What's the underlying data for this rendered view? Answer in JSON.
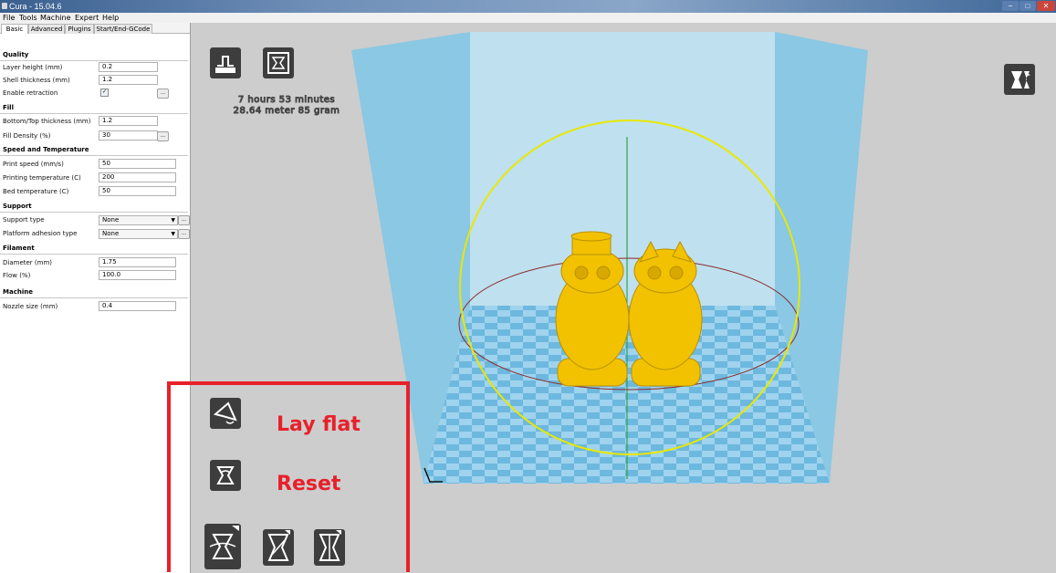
{
  "window": {
    "title": "Cura - 15.04.6",
    "controls": {
      "minimize": "−",
      "maximize": "□",
      "close": "✕"
    },
    "titlebar_color": "#3a5f8f"
  },
  "menu": [
    "File",
    "Tools",
    "Machine",
    "Expert",
    "Help"
  ],
  "tabs": [
    {
      "label": "Basic",
      "active": true
    },
    {
      "label": "Advanced",
      "active": false
    },
    {
      "label": "Plugins",
      "active": false
    },
    {
      "label": "Start/End-GCode",
      "active": false
    }
  ],
  "settings": {
    "quality": {
      "title": "Quality",
      "layer_height": {
        "label": "Layer height (mm)",
        "value": "0.2"
      },
      "shell_thickness": {
        "label": "Shell thickness (mm)",
        "value": "1.2"
      },
      "enable_retraction": {
        "label": "Enable retraction",
        "checked": true,
        "check_mark": "✓"
      }
    },
    "fill": {
      "title": "Fill",
      "bottom_top_thickness": {
        "label": "Bottom/Top thickness (mm)",
        "value": "1.2"
      },
      "fill_density": {
        "label": "Fill Density (%)",
        "value": "30"
      }
    },
    "speed": {
      "title": "Speed and Temperature",
      "print_speed": {
        "label": "Print speed (mm/s)",
        "value": "50"
      },
      "printing_temperature": {
        "label": "Printing temperature (C)",
        "value": "200"
      },
      "bed_temperature": {
        "label": "Bed temperature (C)",
        "value": "50"
      }
    },
    "support": {
      "title": "Support",
      "support_type": {
        "label": "Support type",
        "value": "None"
      },
      "platform_adhesion": {
        "label": "Platform adhesion type",
        "value": "None"
      }
    },
    "filament": {
      "title": "Filament",
      "diameter": {
        "label": "Diameter (mm)",
        "value": "1.75"
      },
      "flow": {
        "label": "Flow (%)",
        "value": "100.0"
      }
    },
    "machine": {
      "title": "Machine",
      "nozzle_size": {
        "label": "Nozzle size (mm)",
        "value": "0.4"
      }
    },
    "ellipsis": "..."
  },
  "viewport": {
    "print_time": "7 hours 53 minutes",
    "print_material": "28.64 meter 85 gram",
    "build_volume_color": "#7fc7e6",
    "model_color": "#f2c200",
    "icons": [
      "load-model-icon",
      "save-toolpath-icon",
      "view-mode-icon",
      "rotate-icon",
      "scale-icon",
      "mirror-icon"
    ]
  },
  "annotation": {
    "color": "#e8202a",
    "lay_flat": "Lay flat",
    "reset": "Reset"
  }
}
